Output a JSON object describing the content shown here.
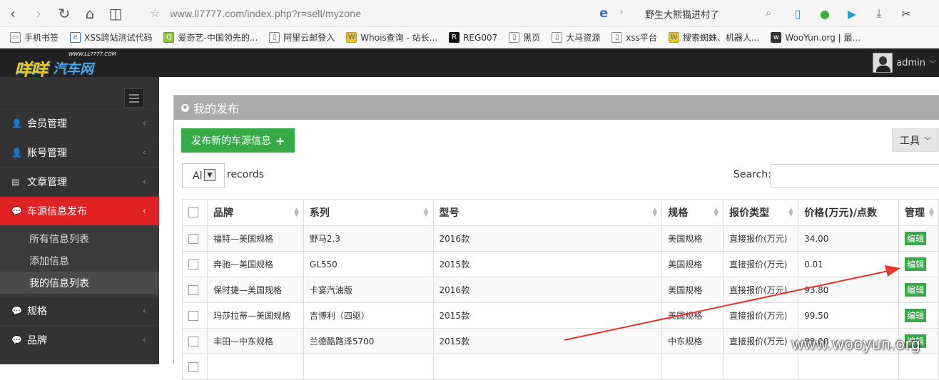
{
  "browser": {
    "url": "www.ll7777.com/index.php?r=sell/myzone",
    "search_text": "野生大熊猫进村了"
  },
  "bookmarks": [
    {
      "label": "手机书签"
    },
    {
      "label": "XSS跨站测试代码"
    },
    {
      "label": "爱奇艺-中国领先的..."
    },
    {
      "label": "阿里云邮登入"
    },
    {
      "label": "Whois查询 - 站长..."
    },
    {
      "label": "REG007"
    },
    {
      "label": "黑页"
    },
    {
      "label": "大马资源"
    },
    {
      "label": "xss平台"
    },
    {
      "label": "搜索蜘蛛、机器人..."
    },
    {
      "label": "WooYun.org | 最..."
    }
  ],
  "header": {
    "logo_main": "咩咩",
    "logo_sub": "汽车网",
    "logo_url": "WWW.LL7777.COM",
    "user_name": "admin"
  },
  "sidebar": {
    "items": [
      {
        "label": "会员管理"
      },
      {
        "label": "账号管理"
      },
      {
        "label": "文章管理"
      },
      {
        "label": "车源信息发布"
      },
      {
        "label": "规格"
      },
      {
        "label": "品牌"
      }
    ],
    "sub_items": [
      {
        "label": "所有信息列表"
      },
      {
        "label": "添加信息"
      },
      {
        "label": "我的信息列表"
      }
    ]
  },
  "main": {
    "panel_title": "我的发布",
    "add_button": "发布新的车源信息",
    "tools_button": "工具",
    "length_value": "Al",
    "records_label": "records",
    "search_label": "Search:",
    "columns": [
      "品牌",
      "系列",
      "型号",
      "规格",
      "报价类型",
      "价格(万元)/点数",
      "管理"
    ],
    "rows": [
      {
        "brand": "福特—美国规格",
        "series": "野马2.3",
        "model": "2016款",
        "spec": "美国规格",
        "quote": "直接报价(万元)",
        "price": "34.00",
        "action": "编辑"
      },
      {
        "brand": "奔驰—美国规格",
        "series": "GL550",
        "model": "2015款",
        "spec": "美国规格",
        "quote": "直接报价(万元)",
        "price": "0.01",
        "action": "编辑"
      },
      {
        "brand": "保时捷—美国规格",
        "series": "卡宴汽油版",
        "model": "2016款",
        "spec": "美国规格",
        "quote": "直接报价(万元)",
        "price": "93.80",
        "action": "编辑"
      },
      {
        "brand": "玛莎拉蒂—美国规格",
        "series": "吉博利（四驱）",
        "model": "2015款",
        "spec": "美国规格",
        "quote": "直接报价(万元)",
        "price": "99.50",
        "action": "编辑"
      },
      {
        "brand": "丰田—中东规格",
        "series": "兰德酷路泽5700",
        "model": "2015款",
        "spec": "中东规格",
        "quote": "直接报价(万元)",
        "price": "88.00",
        "action": "编辑"
      }
    ]
  },
  "watermark": "www.wooyun.org",
  "colors": {
    "accent_red": "#e02222",
    "green": "#35aa47",
    "sidebar_bg": "#333333",
    "panel_title_bg": "#aaaaaa"
  }
}
